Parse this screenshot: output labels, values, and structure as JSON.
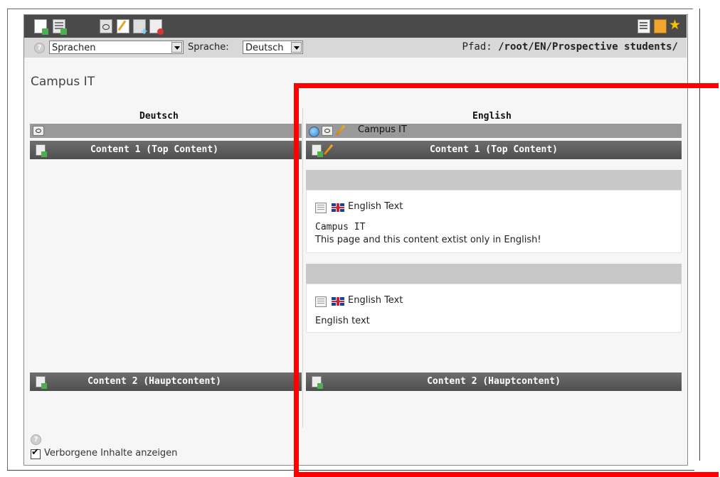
{
  "toolbar": {
    "left_icons": [
      "new-page-icon",
      "new-record-icon",
      "view-page-icon",
      "edit-page-icon",
      "move-page-icon",
      "delete-page-icon"
    ],
    "right_icons": [
      "list-view-icon",
      "clipboard-icon",
      "bookmark-star-icon"
    ]
  },
  "toolbar2": {
    "mode_select_value": "Sprachen",
    "language_label": "Sprache:",
    "language_select_value": "Deutsch",
    "path_label": "Pfad:",
    "path_value": "/root/EN/Prospective students/"
  },
  "page": {
    "title": "Campus IT"
  },
  "columns": {
    "left": {
      "header": "Deutsch",
      "content1_title": "Content 1 (Top Content)",
      "content2_title": "Content 2 (Hauptcontent)"
    },
    "right": {
      "header": "English",
      "page_overlay_title": "Campus IT",
      "content1_title": "Content 1 (Top Content)",
      "content2_title": "Content 2 (Hauptcontent)",
      "elements": [
        {
          "type_label": "English Text",
          "header": "Campus IT",
          "body": "This page and this content extist only in English!"
        },
        {
          "type_label": "English Text",
          "body": "English text"
        }
      ]
    }
  },
  "footer": {
    "show_hidden_label": "Verborgene Inhalte anzeigen",
    "show_hidden_checked": true
  },
  "colors": {
    "toolbar_bg": "#4a4a4a",
    "annotation_red": "#ff0000"
  }
}
